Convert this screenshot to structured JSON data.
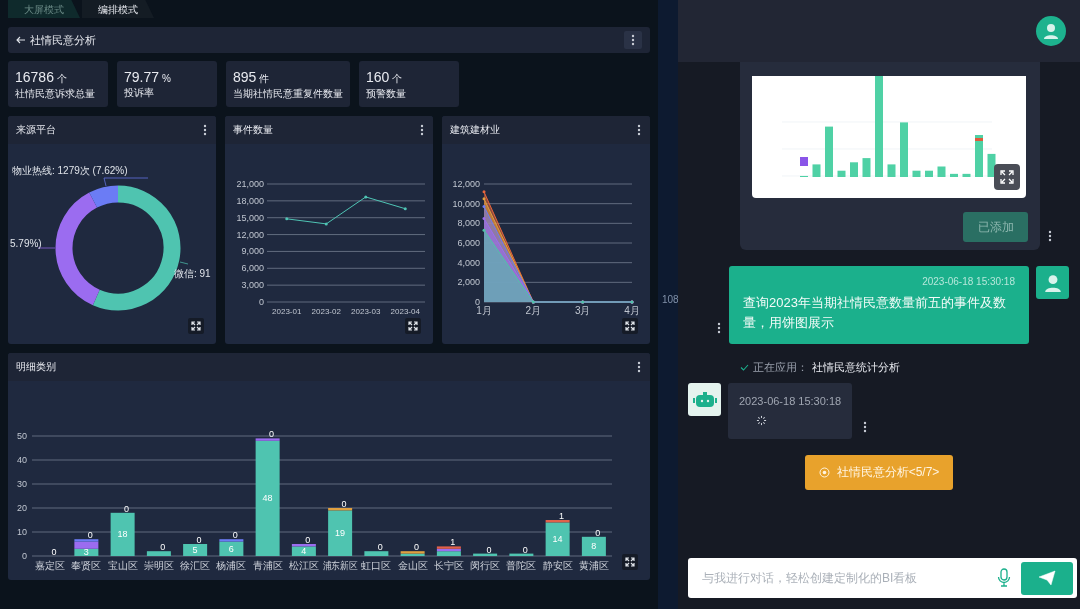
{
  "mode_tabs": [
    {
      "label": "大屏模式",
      "selected": false
    },
    {
      "label": "编排模式",
      "selected": true
    }
  ],
  "page": {
    "title": "社情民意分析"
  },
  "kpis": [
    {
      "value": "16786",
      "unit": "个",
      "label": "社情民意诉求总量"
    },
    {
      "value": "79.77",
      "unit": "%",
      "label": "投诉率"
    },
    {
      "value": "895",
      "unit": "件",
      "label": "当期社情民意重复件数量"
    },
    {
      "value": "160",
      "unit": "个",
      "label": "预警数量"
    }
  ],
  "panels": [
    {
      "kind": "donut",
      "title": "来源平台",
      "labels": [
        "物业热线: 1279次 (7.62%)",
        "5.79%)",
        "微信: 91"
      ]
    },
    {
      "kind": "line",
      "title": "事件数量",
      "chart_data": {
        "type": "line",
        "grid": true,
        "categories": [
          "2023-01",
          "2023-02",
          "2023-03",
          "2023-04"
        ],
        "yticks": [
          0,
          {
            "value": 3000,
            "label": "3,000"
          },
          {
            "value": 6000,
            "label": "6,000"
          },
          {
            "value": 9000,
            "label": "9,000"
          },
          {
            "value": 12000,
            "label": "12,000"
          },
          {
            "value": 15000,
            "label": "15,000"
          },
          {
            "value": 18000,
            "label": "18,000"
          },
          {
            "value": 21000,
            "label": "21,000"
          }
        ],
        "ylim": [
          0,
          21000
        ],
        "series": [
          {
            "color": "#4fc4b4",
            "values": [
              14800,
              13900,
              18700,
              16600
            ]
          }
        ]
      }
    },
    {
      "kind": "area",
      "title": "建筑建材业",
      "chart_data": {
        "type": "area",
        "grid": true,
        "categories": [
          "1月",
          "2月",
          "3月",
          "4月"
        ],
        "yticks": [
          0,
          {
            "value": 2000,
            "label": "2,000"
          },
          {
            "value": 4000,
            "label": "4,000"
          },
          {
            "value": 6000,
            "label": "6,000"
          },
          {
            "value": 8000,
            "label": "8,000"
          },
          {
            "value": 10000,
            "label": "10,000"
          },
          {
            "value": 12000,
            "label": "12,000"
          }
        ],
        "ylim": [
          0,
          12000
        ],
        "series": [
          {
            "color": "#4fc4a8",
            "values": [
              7300,
              0,
              0,
              0
            ]
          },
          {
            "color": "#9b6cf0",
            "values": [
              8500,
              0,
              0,
              0
            ]
          },
          {
            "color": "#6b7cf5",
            "values": [
              9700,
              0,
              0,
              0
            ]
          },
          {
            "color": "#e0a040",
            "values": [
              10500,
              0,
              0,
              0
            ]
          },
          {
            "color": "#e8663c",
            "values": [
              11200,
              0,
              0,
              0
            ]
          }
        ]
      }
    }
  ],
  "detail_panel": {
    "title": "明细类别",
    "chart_data": {
      "type": "bar",
      "grid": true,
      "stacked": true,
      "categories": [
        "嘉定区",
        "奉贤区",
        "宝山区",
        "崇明区",
        "徐汇区",
        "杨浦区",
        "青浦区",
        "松江区",
        "浦东新区",
        "虹口区",
        "金山区",
        "长宁区",
        "闵行区",
        "普陀区",
        "静安区",
        "黄浦区"
      ],
      "yticks": [
        0,
        10,
        20,
        30,
        40,
        50
      ],
      "ylim": [
        0,
        50
      ],
      "series": [
        {
          "color": "#4fc4b0",
          "values": [
            0,
            3,
            18,
            2,
            5,
            6,
            48,
            4,
            19,
            2,
            1,
            2,
            1,
            1,
            14,
            8
          ],
          "value_labels": [
            null,
            "3",
            "18",
            null,
            "5",
            "6",
            "48",
            "4",
            "19",
            null,
            null,
            null,
            null,
            null,
            "14",
            "8"
          ]
        },
        {
          "color": "#9b6cf0",
          "values": [
            0,
            3,
            0,
            0,
            0,
            0,
            1,
            1,
            0,
            0,
            0,
            1,
            0,
            0,
            0,
            0
          ]
        },
        {
          "color": "#6b7cf5",
          "values": [
            0,
            1,
            0,
            0,
            0,
            1,
            0,
            0,
            0,
            0,
            0,
            0,
            0,
            0,
            0,
            0
          ]
        },
        {
          "color": "#e0a040",
          "values": [
            0,
            0,
            0,
            0,
            0,
            0,
            0,
            0,
            1,
            0,
            1,
            0,
            0,
            0,
            0,
            0
          ]
        },
        {
          "color": "#e0604a",
          "values": [
            0,
            0,
            0,
            0,
            0,
            0,
            0,
            0,
            0,
            0,
            0,
            1,
            0,
            0,
            1,
            0
          ],
          "value_labels": [
            "0",
            "0",
            "0",
            "0",
            "0",
            "0",
            "0",
            "0",
            "0",
            "0",
            "0",
            "1",
            "0",
            "0",
            "1",
            "0"
          ]
        }
      ]
    }
  },
  "side_fragment": "108",
  "chat": {
    "added_button": {
      "label": "已添加",
      "disabled": true
    },
    "user_message": {
      "time": "2023-06-18 15:30:18",
      "text": "查询2023年当期社情民意数量前五的事件及数量，用饼图展示"
    },
    "status": {
      "label": "正在应用：",
      "value": "社情民意统计分析"
    },
    "bot_message": {
      "time": "2023-06-18 15:30:18",
      "loading": true
    },
    "skill_button": "社情民意分析<5/7>",
    "input": {
      "placeholder": "与我进行对话，轻松创建定制化的BI看板"
    }
  }
}
